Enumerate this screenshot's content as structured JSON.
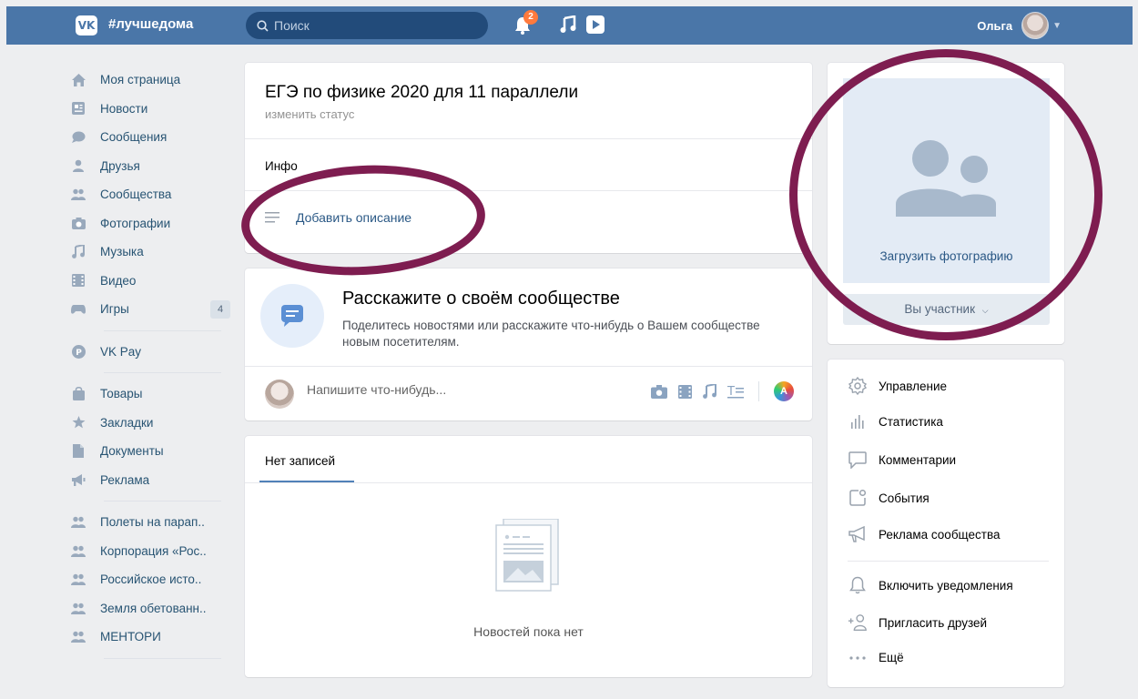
{
  "header": {
    "logo_text": "VK",
    "brand": "#лучшедома",
    "search_placeholder": "Поиск",
    "notifications_count": "2",
    "user_name": "Ольга"
  },
  "leftnav": {
    "items": [
      {
        "label": "Моя страница",
        "icon": "home-icon"
      },
      {
        "label": "Новости",
        "icon": "news-icon"
      },
      {
        "label": "Сообщения",
        "icon": "messages-icon"
      },
      {
        "label": "Друзья",
        "icon": "friends-icon"
      },
      {
        "label": "Сообщества",
        "icon": "communities-icon"
      },
      {
        "label": "Фотографии",
        "icon": "camera-icon"
      },
      {
        "label": "Музыка",
        "icon": "music-icon"
      },
      {
        "label": "Видео",
        "icon": "video-icon"
      },
      {
        "label": "Игры",
        "icon": "games-icon",
        "count": "4"
      }
    ],
    "pay": {
      "label": "VK Pay",
      "icon": "vkpay-icon"
    },
    "items2": [
      {
        "label": "Товары",
        "icon": "bag-icon"
      },
      {
        "label": "Закладки",
        "icon": "star-icon"
      },
      {
        "label": "Документы",
        "icon": "document-icon"
      },
      {
        "label": "Реклама",
        "icon": "megaphone-icon"
      }
    ],
    "groups": [
      {
        "label": "Полеты на парап..",
        "icon": "community-icon"
      },
      {
        "label": "Корпорация «Рос..",
        "icon": "community-icon"
      },
      {
        "label": "Российское исто..",
        "icon": "community-icon"
      },
      {
        "label": "Земля обетованн..",
        "icon": "community-icon"
      },
      {
        "label": "МЕНТОРИ",
        "icon": "community-icon"
      }
    ]
  },
  "group": {
    "title": "ЕГЭ по физике 2020 для 11 параллели",
    "status_link": "изменить статус",
    "info_label": "Инфо",
    "add_description": "Добавить описание"
  },
  "prompt": {
    "title": "Расскажите о своём сообществе",
    "text": "Поделитесь новостями или расскажите что-нибудь о Вашем сообществе новым посетителям.",
    "post_placeholder": "Напишите что-нибудь..."
  },
  "wall": {
    "tab": "Нет записей",
    "empty": "Новостей пока нет"
  },
  "photo": {
    "upload_label": "Загрузить фотографию",
    "member_button": "Вы участник"
  },
  "actions": [
    {
      "label": "Управление",
      "icon": "gear-icon"
    },
    {
      "label": "Статистика",
      "icon": "stats-icon"
    },
    {
      "label": "Комментарии",
      "icon": "comment-icon"
    },
    {
      "label": "События",
      "icon": "event-icon"
    },
    {
      "label": "Реклама сообщества",
      "icon": "megaphone-icon"
    },
    {
      "label": "Включить уведомления",
      "icon": "bell-icon"
    },
    {
      "label": "Пригласить друзей",
      "icon": "invite-icon"
    },
    {
      "label": "Ещё",
      "icon": "more-icon"
    }
  ],
  "colors": {
    "header": "#4a76a8",
    "link": "#2a5885",
    "highlight_ellipse": "#7e1d50"
  }
}
